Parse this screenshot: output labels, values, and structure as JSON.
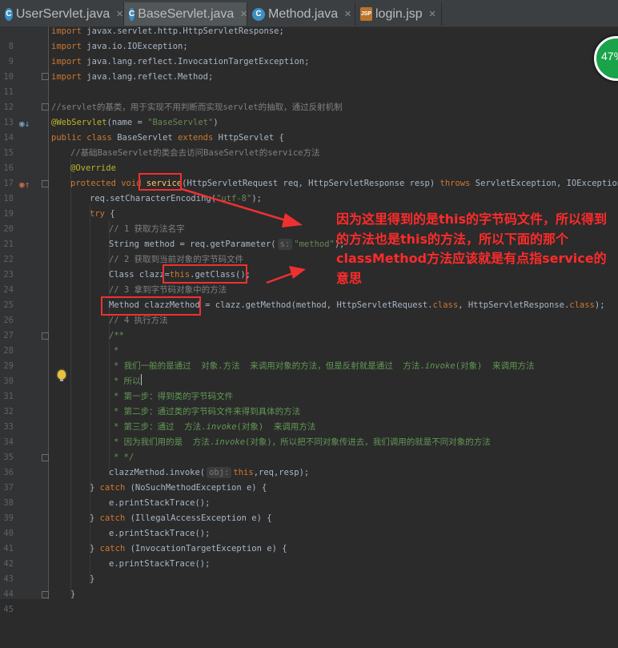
{
  "tabs": [
    {
      "label": "UserServlet.java",
      "icon": "java-class-icon",
      "icon_glyph": "C",
      "active": false
    },
    {
      "label": "BaseServlet.java",
      "icon": "java-class-icon",
      "icon_glyph": "C",
      "active": true
    },
    {
      "label": "Method.java",
      "icon": "java-class-icon",
      "icon_glyph": "C",
      "active": false
    },
    {
      "label": "login.jsp",
      "icon": "jsp-file-icon",
      "icon_glyph": "JSP",
      "active": false
    }
  ],
  "tab_close_glyph": "×",
  "line_numbers": [
    "8",
    "9",
    "10",
    "11",
    "12",
    "13",
    "14",
    "15",
    "16",
    "17",
    "18",
    "19",
    "20",
    "21",
    "22",
    "23",
    "24",
    "25",
    "26",
    "27",
    "28",
    "29",
    "30",
    "31",
    "32",
    "33",
    "34",
    "35",
    "36",
    "37",
    "38",
    "39",
    "40",
    "41",
    "42",
    "43",
    "44",
    "45"
  ],
  "hints": {
    "s": "s:",
    "obj": "obj:"
  },
  "code": {
    "l8": "javax.servlet.http.HttpServletResponse;",
    "l9": "java.io.IOException;",
    "l10": "java.lang.reflect.InvocationTargetException;",
    "l11": "java.lang.reflect.Method;",
    "kw_import": "import",
    "l13": "//servlet的基类，用于实现不用判断而实现servlet的抽取，通过反射机制",
    "l14_ann": "@WebServlet",
    "l14_a": "(name = ",
    "l14_str": "\"BaseServlet\"",
    "l14_b": ")",
    "l15_kw1": "public",
    "l15_kw2": "class",
    "l15_a": "BaseServlet",
    "l15_kw3": "extends",
    "l15_b": "HttpServlet {",
    "l16": "//基础BaseServlet的类会去访问BaseServlet的service方法",
    "l17": "@Override",
    "l18_kw1": "protected",
    "l18_kw2": "void",
    "l18_name": "service",
    "l18_a": "(HttpServletRequest req, HttpServletResponse resp)",
    "l18_kw3": "throws",
    "l18_b": "ServletException, IOException {",
    "l19_a": "req.setCharacterEncoding(",
    "l19_str": "\"utf-8\"",
    "l19_b": ");",
    "l20_kw": "try",
    "l20_b": " {",
    "l21": "// 1 获取方法名字",
    "l22_a": "String method = req.getParameter(",
    "l22_str": "\"method\"",
    "l22_b": ");",
    "l23": "// 2 获取到当前对象的字节码文件",
    "l24_a": "Class clazz=",
    "l24_kw": "this",
    "l24_b": ".getClass();",
    "l25": "// 3 拿到字节码对象中的方法",
    "l26_a": "Method clazzMethod = clazz.getMethod(method, HttpServletRequest.",
    "l26_kw1": "class",
    "l26_b": ", HttpServletResponse.",
    "l26_kw2": "class",
    "l26_c": ");",
    "l27": "// 4 执行方法",
    "l28": "/**",
    "l29": "*",
    "l30_a": "* 我们一般的是通过  对象.方法  来调用对象的方法，但是反射就是通过  方法.",
    "l30_i": "invoke",
    "l30_b": "(对象)  来调用方法",
    "l31": "* 所以",
    "l32": "* 第一步：得到类的字节码文件",
    "l33": "* 第二步：通过类的字节码文件来得到具体的方法",
    "l34_a": "* 第三步：通过  方法.",
    "l34_i": "invoke",
    "l34_b": "(对象)  来调用方法",
    "l35_a": "* 因为我们用的是  方法.",
    "l35_i": "invoke",
    "l35_b": "(对象)，所以把不同对象传进去，我们调用的就是不同对象的方法",
    "l36": "* */",
    "l37_a": "clazzMethod.invoke(",
    "l37_kw": "this",
    "l37_b": ",req,resp);",
    "kw_catch": "catch",
    "l38_a": "} ",
    "l38_b": " (NoSuchMethodException e) {",
    "l39": "e.printStackTrace();",
    "l40_b": " (IllegalAccessException e) {",
    "l42_b": " (InvocationTargetException e) {",
    "l44": "}",
    "l45": "}"
  },
  "annotation_note": "因为这里得到的是this的字节码文件，所以得到的方法也是this的方法，所以下面的那个classMethod方法应该就是有点指service的意思",
  "widget": {
    "label": "47%"
  },
  "colors": {
    "keyword": "#cc7832",
    "comment": "#808080",
    "string": "#6a8759",
    "annotation": "#bbb529",
    "javadoc": "#629755",
    "highlight_box": "#f03030",
    "note_text": "#ff2b2b"
  }
}
